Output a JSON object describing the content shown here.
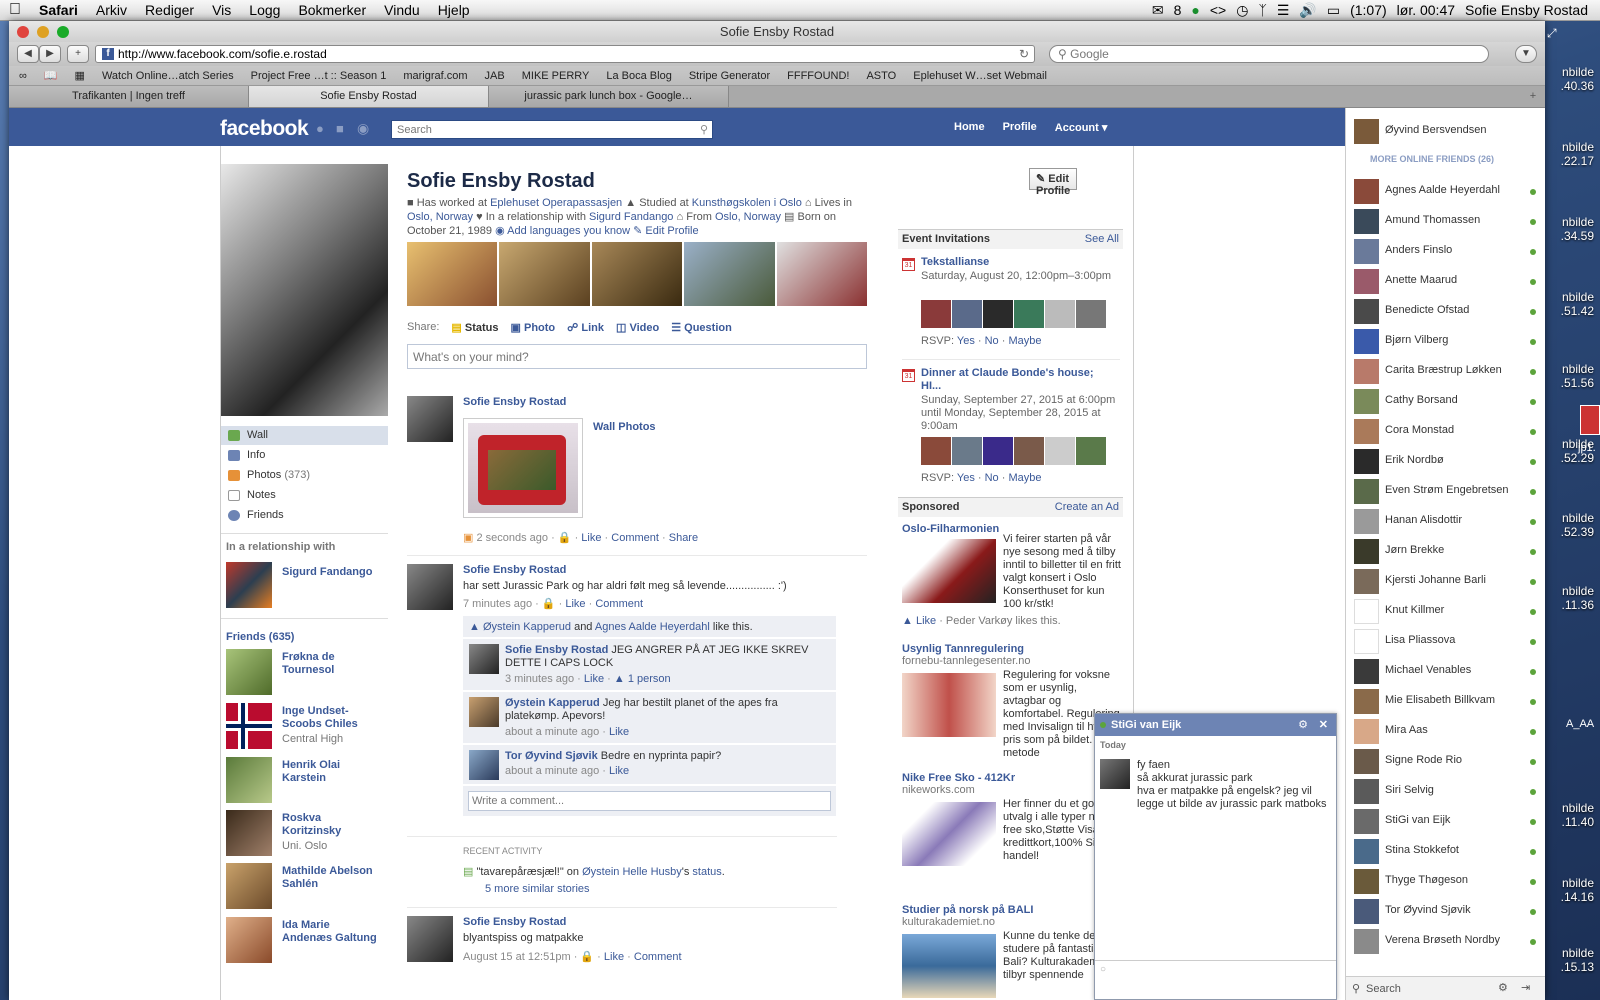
{
  "menubar": {
    "apple": "",
    "items": [
      "Safari",
      "Arkiv",
      "Rediger",
      "Vis",
      "Logg",
      "Bokmerker",
      "Vindu",
      "Hjelp"
    ],
    "status": {
      "mail_count": "8",
      "battery": "(1:07)",
      "clock": "lør. 00:47",
      "user": "Sofie Ensby Rostad"
    }
  },
  "desktop_labels": [
    "nbilde\n.40.36",
    "nbilde\n.22.17",
    "nbilde\n.34.59",
    "nbilde\n.51.42",
    "nbilde\n.51.56",
    "nbilde\n.52.29",
    "nbilde\n.52.39",
    "nbilde\n.11.36",
    "nbilde\n.11.40",
    "nbilde\n.14.16",
    "nbilde\n.15.13"
  ],
  "desktop_side": {
    "jp": "jp1.",
    "aa": "A_AA"
  },
  "window": {
    "title": "Sofie Ensby Rostad"
  },
  "toolbar": {
    "url": "http://www.facebook.com/sofie.e.rostad",
    "search_placeholder": "Google"
  },
  "bookmarks": [
    "Watch Online…atch Series",
    "Project Free …t :: Season 1",
    "marigraf.com",
    "JAB",
    "MIKE PERRY",
    "La Boca Blog",
    "Stripe Generator",
    "FFFFOUND!",
    "ASTO",
    "Eplehuset W…set Webmail"
  ],
  "tabs": [
    "Trafikanten | Ingen treff",
    "Sofie Ensby Rostad",
    "jurassic park lunch box - Google…"
  ],
  "fb": {
    "logo": "facebook",
    "search_placeholder": "Search",
    "nav": {
      "home": "Home",
      "profile": "Profile",
      "account": "Account"
    },
    "left": {
      "nav": [
        {
          "label": "Wall",
          "icon": "wall-icon",
          "color": "#6aa84f"
        },
        {
          "label": "Info",
          "icon": "info-icon",
          "color": "#6d84b4"
        },
        {
          "label": "Photos",
          "count": "(373)",
          "icon": "photos-icon",
          "color": "#e69138"
        },
        {
          "label": "Notes",
          "icon": "notes-icon",
          "color": "#ffffff"
        },
        {
          "label": "Friends",
          "icon": "friends-icon",
          "color": "#6d84b4"
        }
      ],
      "relationship_head": "In a relationship with",
      "relationship_name": "Sigurd Fandango",
      "friends_head": "Friends (635)",
      "friends": [
        {
          "name": "Frøkna de Tournesol",
          "sub": ""
        },
        {
          "name": "Inge Undset-Scoobs Chiles",
          "sub": "Central High"
        },
        {
          "name": "Henrik Olai Karstein",
          "sub": ""
        },
        {
          "name": "Roskva Koritzinsky",
          "sub": "Uni. Oslo"
        },
        {
          "name": "Mathilde Abelson Sahlén",
          "sub": ""
        },
        {
          "name": "Ida Marie Andenæs Galtung",
          "sub": ""
        }
      ]
    },
    "profile": {
      "name": "Sofie Ensby Rostad",
      "edit_profile": "Edit Profile",
      "info": {
        "worked_pre": "Has worked at ",
        "worked": "Eplehuset Operapassasjen",
        "studied_pre": "Studied at ",
        "studied": "Kunsthøgskolen i Oslo",
        "lives_pre": "Lives in ",
        "lives": "Oslo, Norway",
        "rel_pre": "In a relationship with ",
        "rel": "Sigurd Fandango",
        "from_pre": "From ",
        "from": "Oslo, Norway",
        "born": "Born on October 21, 1989",
        "languages": "Add languages you know",
        "edit": "Edit Profile"
      }
    },
    "share": {
      "label": "Share:",
      "items": [
        "Status",
        "Photo",
        "Link",
        "Video",
        "Question"
      ],
      "composer": "What's on your mind?"
    },
    "posts": [
      {
        "name": "Sofie Ensby Rostad",
        "album": "Wall Photos",
        "time": "2 seconds ago",
        "actions": [
          "Like",
          "Comment",
          "Share"
        ]
      },
      {
        "name": "Sofie Ensby Rostad",
        "text": "har sett Jurassic Park og har aldri følt meg så levende................ :')",
        "time": "7 minutes ago",
        "actions": [
          "Like",
          "Comment"
        ],
        "likes": {
          "a": "Øystein Kapperud",
          "and": " and ",
          "b": "Agnes Aalde Heyerdahl",
          "rest": " like this."
        },
        "comments": [
          {
            "name": "Sofie Ensby Rostad",
            "text": "JEG ANGRER PÅ AT JEG IKKE SKREV DETTE I CAPS LOCK",
            "time": "3 minutes ago",
            "like": "Like",
            "extra": "1 person"
          },
          {
            "name": "Øystein Kapperud",
            "text": "Jeg har bestilt planet of the apes fra platekømp. Apevors!",
            "time": "about a minute ago",
            "like": "Like"
          },
          {
            "name": "Tor Øyvind Sjøvik",
            "text": "Bedre en nyprinta papir?",
            "time": "about a minute ago",
            "like": "Like"
          }
        ],
        "write_comment": "Write a comment..."
      }
    ],
    "recent": {
      "head": "RECENT ACTIVITY",
      "text1": "\"tavarepåræsjæl!\" on ",
      "link1": "Øystein Helle Husby",
      "text2": "'s ",
      "link2": "status",
      "more": "5 more similar stories"
    },
    "post3": {
      "name": "Sofie Ensby Rostad",
      "text": "blyantspiss og matpakke",
      "time": "August 15 at 12:51pm",
      "actions": [
        "Like",
        "Comment"
      ]
    },
    "events": {
      "head": "Event Invitations",
      "see_all": "See All",
      "list": [
        {
          "title": "Tekstallianse",
          "date": "Saturday, August 20, 12:00pm–3:00pm"
        },
        {
          "title": "Dinner at Claude Bonde's house; HI...",
          "date": "Sunday, September 27, 2015 at 6:00pm until Monday, September 28, 2015 at 9:00am"
        }
      ],
      "rsvp": {
        "label": "RSVP:",
        "yes": "Yes",
        "no": "No",
        "maybe": "Maybe"
      },
      "cal_day": "31"
    },
    "sponsored": {
      "head": "Sponsored",
      "create": "Create an Ad",
      "ads": [
        {
          "title": "Oslo-Filharmonien",
          "url": "",
          "body": "Vi feirer starten på vår nye sesong med å tilby inntil to billetter til en fritt valgt konsert i Oslo Konserthuset for kun 100 kr/stk!",
          "like": "Like",
          "liker": "Peder Varkøy likes this."
        },
        {
          "title": "Usynlig Tannregulering",
          "url": "fornebu-tannlegesenter.no",
          "body": "Regulering for voksne som er usynlig, avtagbar og komfortabel. Regulering med Invisalign til hvere pris som på bildet. Ny metode"
        },
        {
          "title": "Nike Free Sko - 412Kr",
          "url": "nikeworks.com",
          "body": "Her finner du et godt utvalg i alle typer nike free sko,Støtte Visa kredittkort,100% Sikker handel!"
        },
        {
          "title": "Studier på norsk på BALI",
          "url": "kulturakademiet.no",
          "body": "Kunne du tenke deg å studere på fantastiske Bali? Kulturakademiet tilbyr spennende"
        }
      ]
    },
    "chat_window": {
      "name": "StiGi van Eijk",
      "today": "Today",
      "messages": [
        "fy faen",
        "så akkurat jurassic park",
        "hva er matpakke på engelsk? jeg vil legge ut bilde av jurassic park matboks"
      ]
    },
    "chat_sidebar": {
      "top": "Øyvind Bersvendsen",
      "more": "MORE ONLINE FRIENDS (26)",
      "friends": [
        "Agnes Aalde Heyerdahl",
        "Amund Thomassen",
        "Anders Finslo",
        "Anette Maarud",
        "Benedicte Ofstad",
        "Bjørn Vilberg",
        "Carita Bræstrup Løkken",
        "Cathy Borsand",
        "Cora Monstad",
        "Erik Nordbø",
        "Even Strøm Engebretsen",
        "Hanan Alisdottir",
        "Jørn Brekke",
        "Kjersti Johanne Barli",
        "Knut Killmer",
        "Lisa Pliassova",
        "Michael Venables",
        "Mie Elisabeth Billkvam",
        "Mira Aas",
        "Signe Rode Rio",
        "Siri Selvig",
        "StiGi van Eijk",
        "Stina Stokkefot",
        "Thyge Thøgeson",
        "Tor Øyvind Sjøvik",
        "Verena Brøseth Nordby"
      ],
      "search": "Search"
    }
  }
}
